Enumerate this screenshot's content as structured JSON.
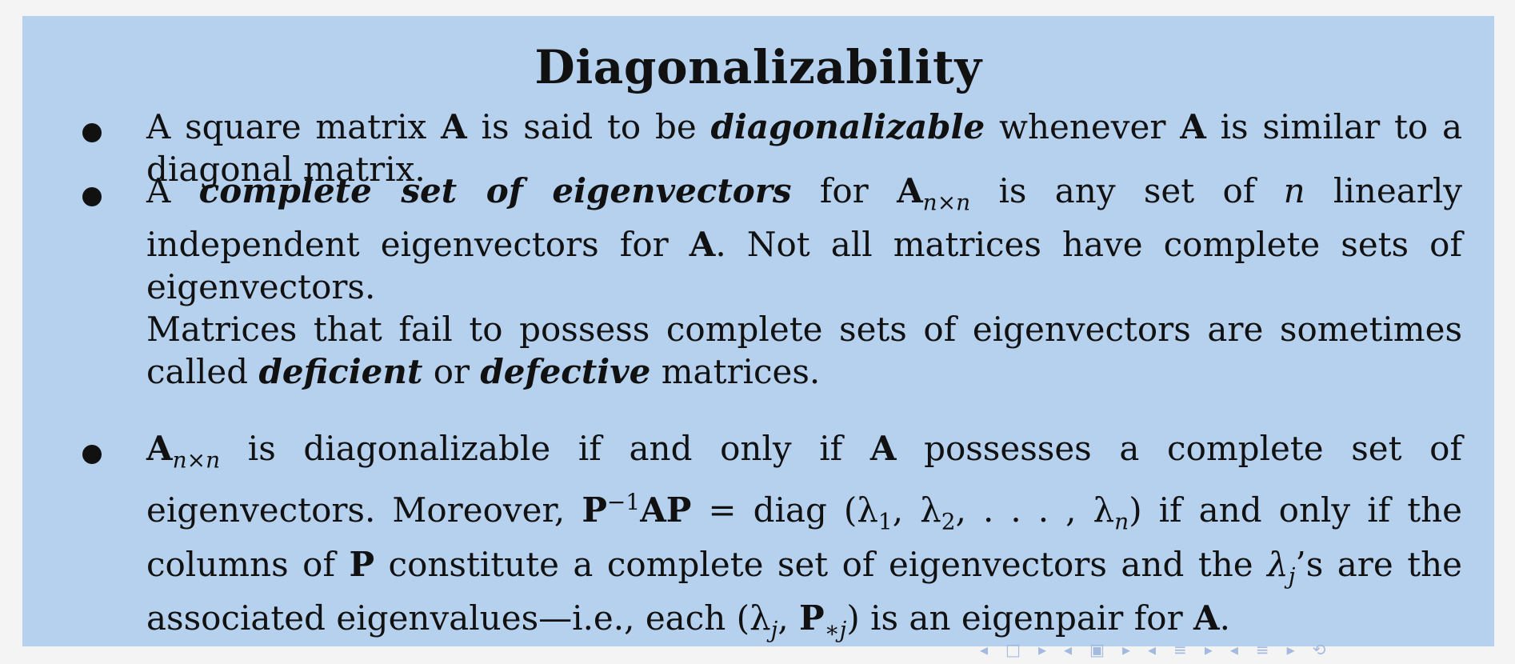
{
  "title": "Diagonalizability",
  "items": [
    {
      "line": "A square matrix A is said to be diagonalizable whenever A is similar to a diagonal matrix.",
      "parts": {
        "t1": "A square matrix ",
        "A1": "A",
        "t2": " is said to be ",
        "term": "diagonalizable",
        "t3": " whenever ",
        "A2": "A",
        "t4": " is similar to a diagonal matrix."
      }
    },
    {
      "parts": {
        "t1": "A ",
        "term": "complete set of eigenvectors",
        "t2": " for ",
        "A1": "A",
        "sub1": "n×n",
        "t3": " is any set of ",
        "n": "n",
        "t4": " linearly independent eigenvectors for ",
        "A2": "A",
        "t5": ". Not all matrices have complete sets of eigenvectors.",
        "t6": "Matrices that fail to possess complete sets of eigenvectors are sometimes called ",
        "term2": "deficient",
        "t7": " or ",
        "term3": "defective",
        "t8": " matrices."
      }
    },
    {
      "parts": {
        "A1": "A",
        "sub1": "n×n",
        "t1": " is diagonalizable if and only if ",
        "A2": "A",
        "t2": " possesses a complete set of eigenvectors. Moreover, ",
        "P1": "P",
        "sup1": "−1",
        "AP": "AP",
        "t3": " = diag (λ",
        "s1": "1",
        "t4": ", λ",
        "s2": "2",
        "t5": ", . . . , λ",
        "s3": "n",
        "t6": ") if and only if the columns of ",
        "P2": "P",
        "t7": " constitute a complete set of eigenvectors and the ",
        "lam": "λ",
        "sj": "j",
        "t8": "’s are the associated eigenvalues—i.e., each (λ",
        "sj2": "j",
        "t9": ", ",
        "P3": "P",
        "sj3": "∗j",
        "t10": ") is an eigenpair for ",
        "A3": "A",
        "t11": "."
      }
    }
  ],
  "nav": [
    "◂",
    "□",
    "▸",
    "◂",
    "▣",
    "▸",
    "◂",
    "≡",
    "▸",
    "◂",
    "≡",
    "▸",
    "⟲"
  ]
}
